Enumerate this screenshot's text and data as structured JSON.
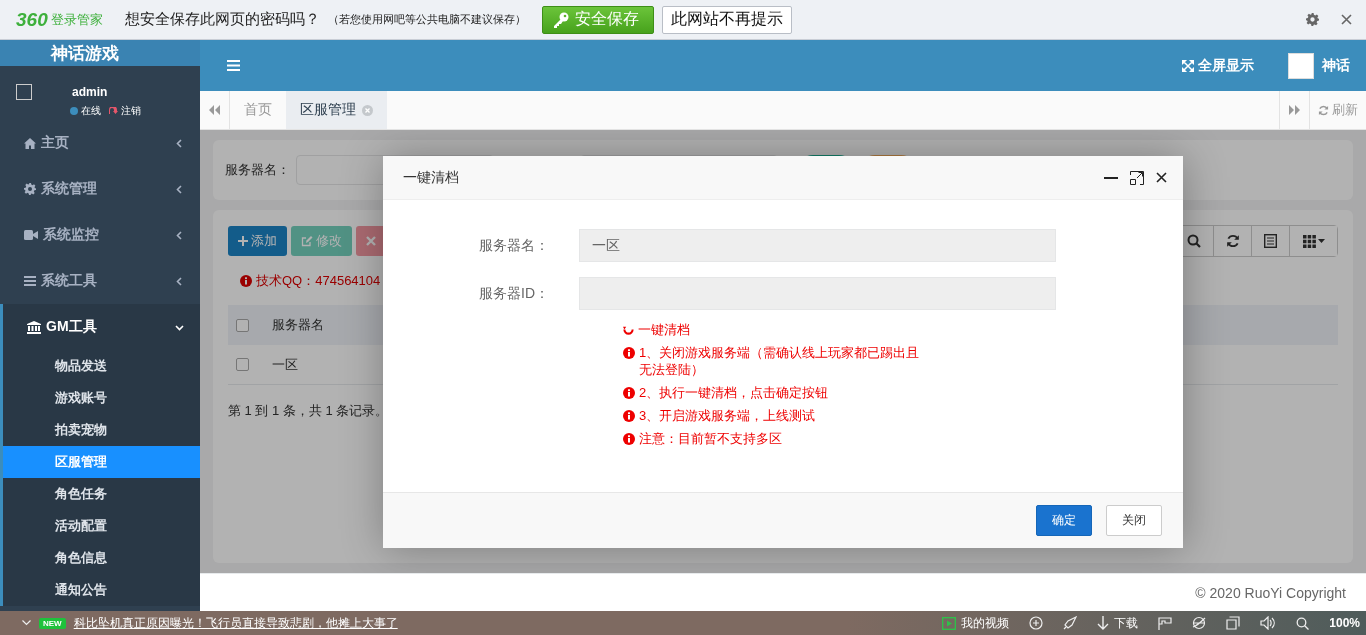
{
  "password_bar": {
    "brand": "360",
    "brand_name": "登录管家",
    "prompt": "想安全保存此网页的密码吗？",
    "hint": "（若您使用网吧等公共电脑不建议保存）",
    "save_button": "安全保存",
    "never_button": "此网站不再提示"
  },
  "sidebar": {
    "logo": "神话游戏",
    "user": {
      "name": "admin",
      "status": "在线",
      "logout": "注销"
    },
    "menu": [
      {
        "label": "主页",
        "expanded": false
      },
      {
        "label": "系统管理",
        "expanded": false
      },
      {
        "label": "系统监控",
        "expanded": false
      },
      {
        "label": "系统工具",
        "expanded": false
      },
      {
        "label": "GM工具",
        "expanded": true,
        "children": [
          {
            "label": "物品发送",
            "selected": false
          },
          {
            "label": "游戏账号",
            "selected": false
          },
          {
            "label": "拍卖宠物",
            "selected": false
          },
          {
            "label": "区服管理",
            "selected": true
          },
          {
            "label": "角色任务",
            "selected": false
          },
          {
            "label": "活动配置",
            "selected": false
          },
          {
            "label": "角色信息",
            "selected": false
          },
          {
            "label": "通知公告",
            "selected": false
          }
        ]
      }
    ]
  },
  "header": {
    "fullscreen": "全屏显示",
    "user": "神话"
  },
  "tabs": [
    {
      "label": "首页",
      "selected": false,
      "closable": false
    },
    {
      "label": "区服管理",
      "selected": true,
      "closable": true
    }
  ],
  "refresh": "刷新",
  "search_form": {
    "label": "服务器名："
  },
  "toolbar": [
    {
      "label": "添加",
      "kind": "add",
      "disabled": false
    },
    {
      "label": "修改",
      "kind": "edit",
      "disabled": true
    },
    {
      "kind": "delete",
      "disabled": true
    }
  ],
  "notice": "技术QQ：474564104",
  "table": {
    "columns": [
      "服务器名"
    ],
    "header_checked": false,
    "rows": [
      {
        "cells": [
          "一区"
        ],
        "checked": false
      }
    ],
    "summary": "第 1 到 1 条，共 1 条记录。"
  },
  "footer": "© 2020 RuoYi Copyright",
  "dialog": {
    "title": "一键清档",
    "fields": [
      {
        "label": "服务器名：",
        "value": "一区"
      },
      {
        "label": "服务器ID："
      }
    ],
    "notes": [
      {
        "kind": "heading",
        "text": "一键清档"
      },
      {
        "kind": "step",
        "text": "1、关闭游戏服务端（需确认线上玩家都已踢出且无法登陆）"
      },
      {
        "kind": "step",
        "text": "2、执行一键清档，点击确定按钮"
      },
      {
        "kind": "step",
        "text": "3、开启游戏服务端，上线测试"
      },
      {
        "kind": "step",
        "text": "注意：目前暂不支持多区"
      }
    ],
    "buttons": [
      {
        "label": "确定",
        "kind": "primary"
      },
      {
        "label": "关闭",
        "kind": "default"
      }
    ]
  },
  "status_bar": {
    "badge": "NEW",
    "news": "科比坠机真正原因曝光！飞行员直接导致悲剧，他摊上大事了",
    "video": "我的视频",
    "download": "下载",
    "zoom": "100%"
  }
}
